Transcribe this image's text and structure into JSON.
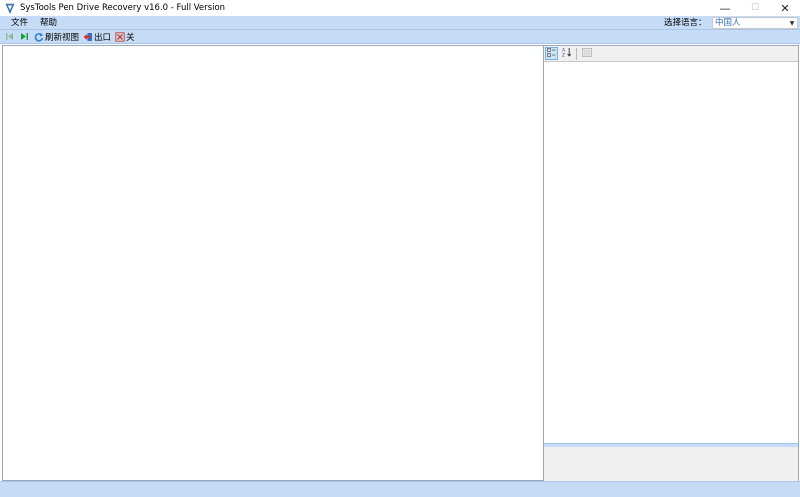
{
  "window": {
    "title": "SysTools Pen Drive Recovery v16.0 - Full Version",
    "controls": {
      "minimize": "—",
      "maximize": "☐",
      "close": "✕"
    }
  },
  "menu": {
    "items": [
      "文件",
      "帮助"
    ],
    "language_label": "选择语言：",
    "language_value": "中国人"
  },
  "toolbar": {
    "refresh_label": "刷新视图",
    "export_label": "出口",
    "close_label": "关"
  },
  "icons": {
    "app": "shield-icon",
    "first": "first-page-icon",
    "next": "next-page-icon",
    "refresh": "refresh-icon",
    "export": "export-icon",
    "close": "close-icon",
    "categorized": "categorized-view-icon",
    "alphabetical": "sort-alphabetical-icon",
    "pages": "property-pages-icon"
  },
  "colors": {
    "bar": "#c6dcf6",
    "accent": "#2d6fb8"
  }
}
